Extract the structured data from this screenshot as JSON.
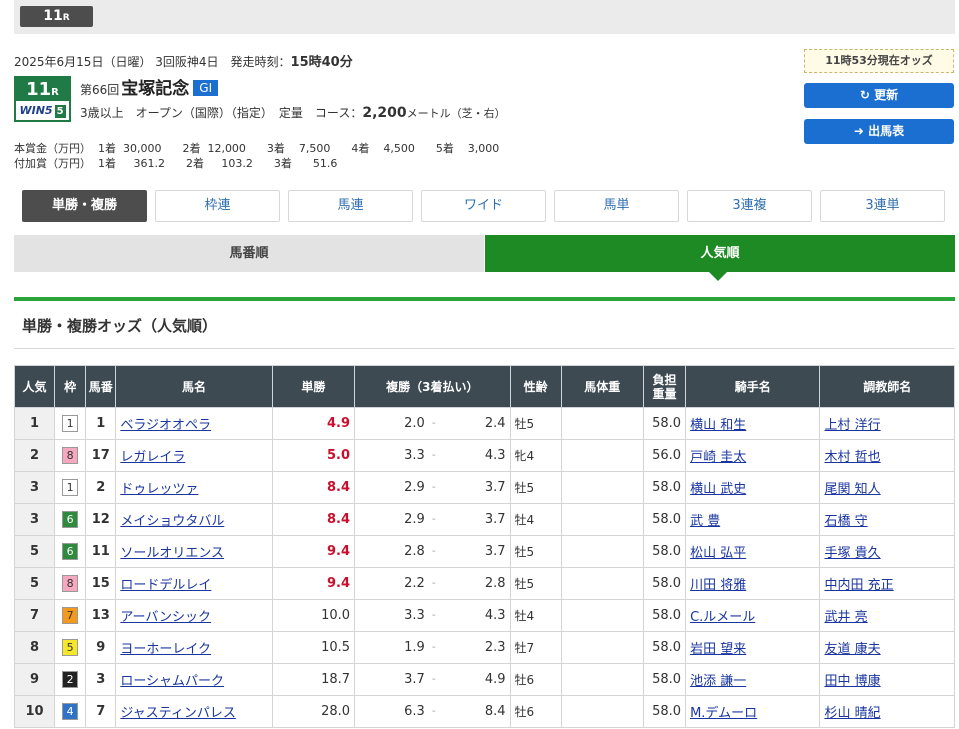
{
  "header": {
    "race_number": "11",
    "race_suffix": "R"
  },
  "race": {
    "date_info": "2025年6月15日（日曜） 3回阪神4日　発走時刻：",
    "post_time": "15時40分",
    "badge_number": "11",
    "badge_suffix": "R",
    "badge_win5": "WIN5",
    "badge_win5_num": "5",
    "edition": "第66回",
    "name": "宝塚記念",
    "grade": "GI",
    "conditions": "3歳以上　オープン（国際）（指定）　定量　コース：",
    "distance": "2,200",
    "distance_unit": "メートル（芝・右）",
    "prize_line1": "本賞金（万円）  1着  30,000      2着  12,000      3着    7,500      4着    4,500      5着    3,000",
    "prize_line2": "付加賞（万円）  1着     361.2      2着     103.2      3着      51.6"
  },
  "side": {
    "odds_time": "11時53分現在オッズ",
    "refresh_label": "↻ 更新",
    "entries_label": "➜ 出馬表"
  },
  "bet_tabs": [
    "単勝・複勝",
    "枠連",
    "馬連",
    "ワイド",
    "馬単",
    "3連複",
    "3連単"
  ],
  "sort_tabs": {
    "by_number": "馬番順",
    "by_popularity": "人気順"
  },
  "section_title": "単勝・複勝オッズ（人気順）",
  "columns": {
    "rank": "人気",
    "waku": "枠",
    "num": "馬番",
    "name": "馬名",
    "win": "単勝",
    "place": "複勝（3着払い）",
    "sex_age": "性齢",
    "body_weight": "馬体重",
    "weight_carried": "負担\n重量",
    "jockey": "騎手名",
    "trainer": "調教師名"
  },
  "rows": [
    {
      "rank": "1",
      "waku": "1",
      "num": "1",
      "name": "ベラジオオペラ",
      "win": "4.9",
      "win_hi": true,
      "plo": "2.0",
      "phi": "2.4",
      "sex": "牡5",
      "kg": "58.0",
      "jockey": "横山 和生",
      "trainer": "上村 洋行"
    },
    {
      "rank": "2",
      "waku": "8",
      "num": "17",
      "name": "レガレイラ",
      "win": "5.0",
      "win_hi": true,
      "plo": "3.3",
      "phi": "4.3",
      "sex": "牝4",
      "kg": "56.0",
      "jockey": "戸崎 圭太",
      "trainer": "木村 哲也"
    },
    {
      "rank": "3",
      "waku": "1",
      "num": "2",
      "name": "ドゥレッツァ",
      "win": "8.4",
      "win_hi": true,
      "plo": "2.9",
      "phi": "3.7",
      "sex": "牡5",
      "kg": "58.0",
      "jockey": "横山 武史",
      "trainer": "尾関 知人"
    },
    {
      "rank": "3",
      "waku": "6",
      "num": "12",
      "name": "メイショウタバル",
      "win": "8.4",
      "win_hi": true,
      "plo": "2.9",
      "phi": "3.7",
      "sex": "牡4",
      "kg": "58.0",
      "jockey": "武 豊",
      "trainer": "石橋 守"
    },
    {
      "rank": "5",
      "waku": "6",
      "num": "11",
      "name": "ソールオリエンス",
      "win": "9.4",
      "win_hi": true,
      "plo": "2.8",
      "phi": "3.7",
      "sex": "牡5",
      "kg": "58.0",
      "jockey": "松山 弘平",
      "trainer": "手塚 貴久"
    },
    {
      "rank": "5",
      "waku": "8",
      "num": "15",
      "name": "ロードデルレイ",
      "win": "9.4",
      "win_hi": true,
      "plo": "2.2",
      "phi": "2.8",
      "sex": "牡5",
      "kg": "58.0",
      "jockey": "川田 将雅",
      "trainer": "中内田 充正"
    },
    {
      "rank": "7",
      "waku": "7",
      "num": "13",
      "name": "アーバンシック",
      "win": "10.0",
      "win_hi": false,
      "plo": "3.3",
      "phi": "4.3",
      "sex": "牡4",
      "kg": "58.0",
      "jockey": "C.ルメール",
      "trainer": "武井 亮"
    },
    {
      "rank": "8",
      "waku": "5",
      "num": "9",
      "name": "ヨーホーレイク",
      "win": "10.5",
      "win_hi": false,
      "plo": "1.9",
      "phi": "2.3",
      "sex": "牡7",
      "kg": "58.0",
      "jockey": "岩田 望来",
      "trainer": "友道 康夫"
    },
    {
      "rank": "9",
      "waku": "2",
      "num": "3",
      "name": "ローシャムパーク",
      "win": "18.7",
      "win_hi": false,
      "plo": "3.7",
      "phi": "4.9",
      "sex": "牡6",
      "kg": "58.0",
      "jockey": "池添 謙一",
      "trainer": "田中 博康"
    },
    {
      "rank": "10",
      "waku": "4",
      "num": "7",
      "name": "ジャスティンパレス",
      "win": "28.0",
      "win_hi": false,
      "plo": "6.3",
      "phi": "8.4",
      "sex": "牡6",
      "kg": "58.0",
      "jockey": "M.デムーロ",
      "trainer": "杉山 晴紀"
    }
  ],
  "waku_colors": {
    "1": {
      "bg": "#ffffff",
      "fg": "#333333"
    },
    "2": {
      "bg": "#222222",
      "fg": "#ffffff"
    },
    "3": {
      "bg": "#e8352e",
      "fg": "#ffffff"
    },
    "4": {
      "bg": "#2f73c9",
      "fg": "#ffffff"
    },
    "5": {
      "bg": "#f6e72b",
      "fg": "#333333"
    },
    "6": {
      "bg": "#2e8a3c",
      "fg": "#ffffff"
    },
    "7": {
      "bg": "#f39a1e",
      "fg": "#333333"
    },
    "8": {
      "bg": "#f5a9c0",
      "fg": "#333333"
    }
  }
}
